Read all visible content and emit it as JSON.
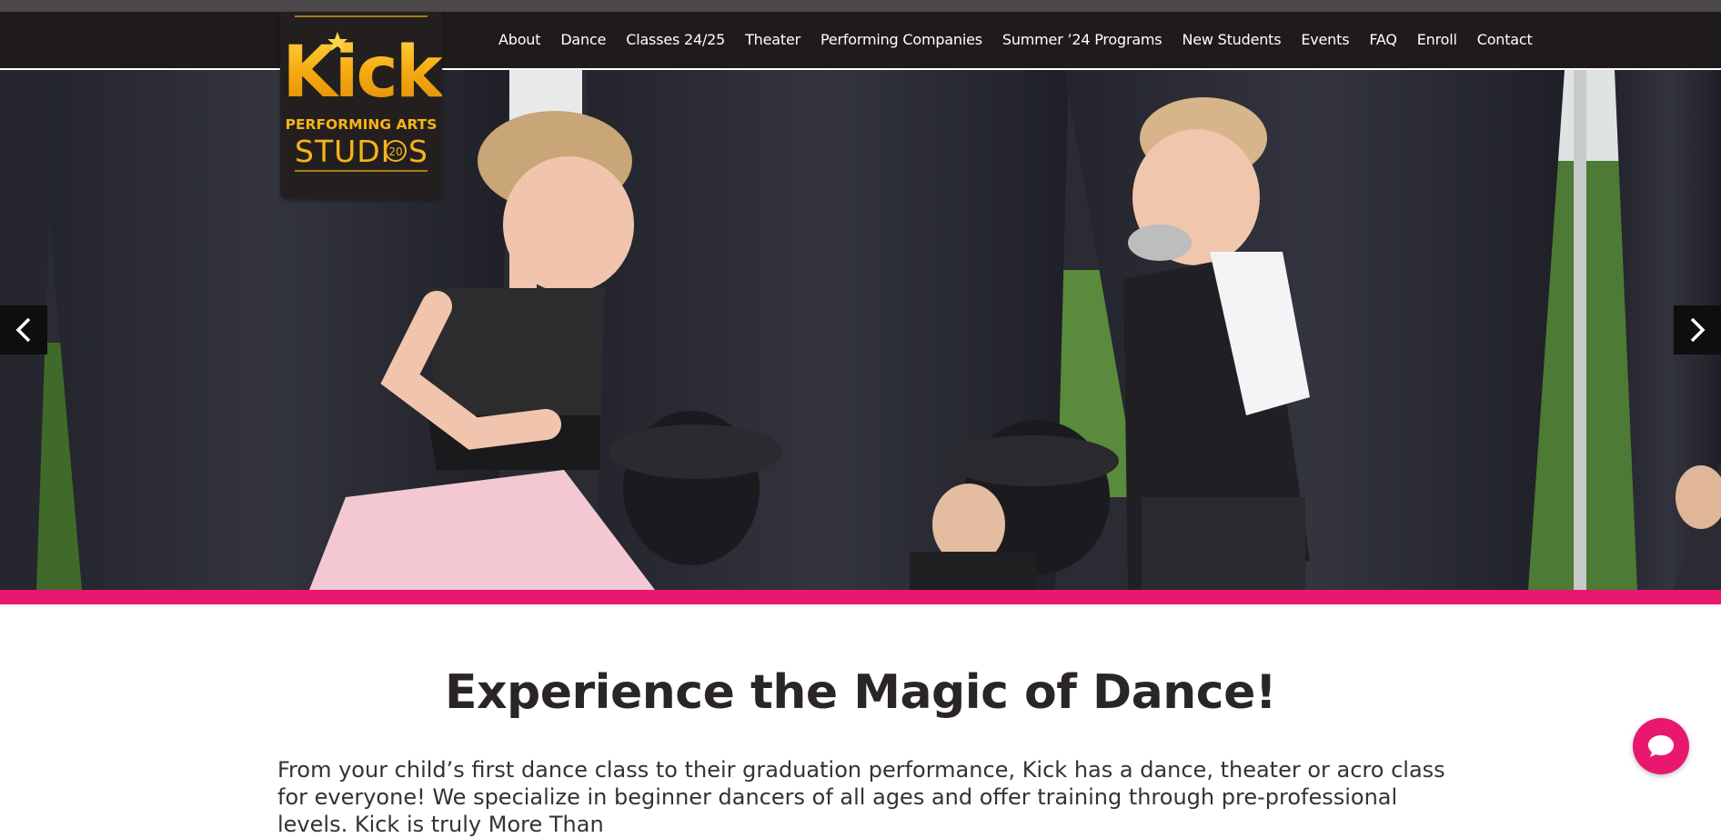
{
  "logo": {
    "word": "Kick",
    "line1": "PERFORMING ARTS",
    "line2_left": "STUDI",
    "badge": "20",
    "line2_right": "S",
    "alt": "Kick Performing Arts Studios"
  },
  "nav": {
    "items": [
      {
        "label": "About"
      },
      {
        "label": "Dance"
      },
      {
        "label": "Classes 24/25"
      },
      {
        "label": "Theater"
      },
      {
        "label": "Performing Companies"
      },
      {
        "label": "Summer ’24 Programs"
      },
      {
        "label": "New Students"
      },
      {
        "label": "Events"
      },
      {
        "label": "FAQ"
      },
      {
        "label": "Enroll"
      },
      {
        "label": "Contact"
      }
    ]
  },
  "hero": {
    "prev_icon": "chevron-left-icon",
    "next_icon": "chevron-right-icon"
  },
  "main": {
    "headline": "Experience the Magic of Dance!",
    "intro": "From your child’s first dance class to their graduation performance, Kick has a dance, theater or acro class for everyone! We specialize in beginner dancers of all ages and offer training through pre-professional levels. Kick is truly More Than"
  },
  "chat": {
    "icon": "chat-bubble-icon"
  },
  "colors": {
    "accent": "#e8186f",
    "nav_bg": "#1f1b1b",
    "gold": "#f6b418",
    "text": "#2b2626"
  }
}
